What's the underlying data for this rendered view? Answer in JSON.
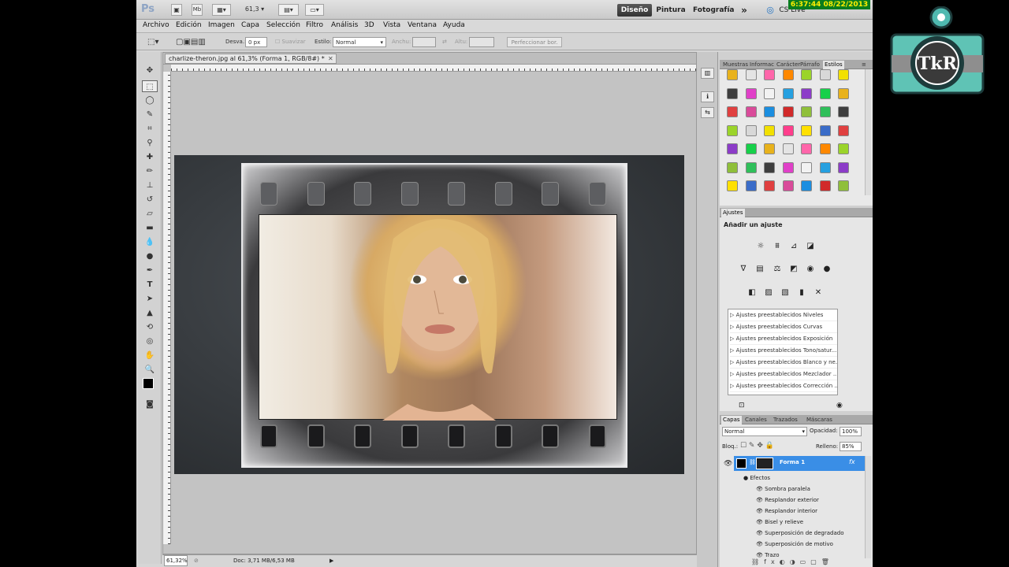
{
  "app": {
    "logo": "Ps",
    "zoom_value": "61,3"
  },
  "workspaces": {
    "design": "Diseño",
    "paint": "Pintura",
    "photo": "Fotografía",
    "more": "»",
    "cs_live": "CS Live"
  },
  "clock": "6:37:44  08/22/2013",
  "menu": [
    "Archivo",
    "Edición",
    "Imagen",
    "Capa",
    "Selección",
    "Filtro",
    "Análisis",
    "3D",
    "Vista",
    "Ventana",
    "Ayuda"
  ],
  "options": {
    "feather_label": "Desva.:",
    "feather_value": "0 px",
    "smooth_label": "Suavizar",
    "style_label": "Estilo:",
    "style_value": "Normal",
    "width_label": "Anchu:",
    "height_label": "Altu:",
    "refine_button": "Perfeccionar bor."
  },
  "document": {
    "tab_title": "charlize-theron.jpg al 61,3% (Forma 1, RGB/8#) *"
  },
  "status": {
    "zoom": "61,32%",
    "doc_size": "Doc: 3,71 MB/6,53 MB"
  },
  "styles_panel": {
    "tabs": [
      "Muestras",
      "Informac",
      "Carácter",
      "Párrafo",
      "Estilos"
    ],
    "active_tab": "Estilos"
  },
  "adjust_panel": {
    "tab": "Ajustes",
    "heading": "Añadir un ajuste",
    "presets": [
      "Ajustes preestablecidos Niveles",
      "Ajustes preestablecidos Curvas",
      "Ajustes preestablecidos Exposición",
      "Ajustes preestablecidos Tono/satur...",
      "Ajustes preestablecidos Blanco y ne...",
      "Ajustes preestablecidos Mezclador ...",
      "Ajustes preestablecidos Corrección ..."
    ]
  },
  "layers_panel": {
    "tabs": [
      "Capas",
      "Canales",
      "Trazados",
      "Máscaras"
    ],
    "blend_mode": "Normal",
    "opacity_label": "Opacidad:",
    "opacity_value": "100%",
    "lock_label": "Bloq.:",
    "fill_label": "Relleno:",
    "fill_value": "85%",
    "layer_name": "Forma 1",
    "fx": "fx",
    "effects_label": "Efectos",
    "effects": [
      "Sombra paralela",
      "Resplandor exterior",
      "Resplandor interior",
      "Bisel y relieve",
      "Superposición de degradado",
      "Superposición de motivo",
      "Trazo"
    ]
  },
  "logo": {
    "text": "TkR"
  }
}
